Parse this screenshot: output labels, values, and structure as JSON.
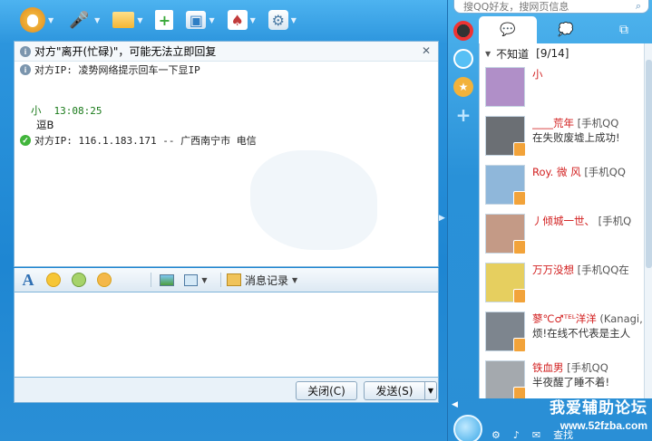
{
  "toolbar": {
    "icons": [
      "camera-icon",
      "microphone-icon",
      "folder-icon",
      "add-app-icon",
      "remote-icon",
      "game-icon",
      "settings-icon"
    ]
  },
  "messages": {
    "notice": "对方\"离开(忙碌)\"，可能无法立即回复",
    "ip_hint": "对方IP: 凌势网络提示回车一下显IP",
    "sender": "小",
    "time": "13:08:25",
    "text": "逗B",
    "ip_result": "对方IP: 116.1.183.171 -- 广西南宁市 电信"
  },
  "format_bar": {
    "history_label": "消息记录"
  },
  "footer": {
    "close_label": "关闭(C)",
    "send_label": "发送(S)"
  },
  "qq": {
    "search_placeholder": "搜QQ好友，搜网页信息",
    "group": {
      "name": "不知道",
      "count": "[9/14]"
    },
    "contacts": [
      {
        "name": "小",
        "tag": "",
        "status": "",
        "avatar_color": "#b08fc8"
      },
      {
        "name": "____荒年",
        "tag": "[手机QQ",
        "status": "在失败废墟上成功!",
        "avatar_color": "#6b6f74"
      },
      {
        "name": "Roy. 微 风",
        "tag": "[手机QQ",
        "status": "",
        "avatar_color": "#8fb7da"
      },
      {
        "name": "丿倾城一世、",
        "tag": "[手机Q",
        "status": "",
        "avatar_color": "#c49a86"
      },
      {
        "name": "万万没想",
        "tag": "[手机QQ在",
        "status": "",
        "avatar_color": "#e6cf5f"
      },
      {
        "name": "蓼℃♂ᵀᴱᴸ洋洋",
        "tag": "(Kanagi,",
        "status": "烦!在线不代表是主人",
        "avatar_color": "#7d858e"
      },
      {
        "name": "铁血男",
        "tag": "[手机QQ",
        "status": "半夜醒了睡不着!",
        "avatar_color": "#a4a9ae"
      }
    ]
  },
  "watermark": {
    "title": "我爱辅助论坛",
    "url": "www.52fzba.com",
    "partial": "查找"
  }
}
